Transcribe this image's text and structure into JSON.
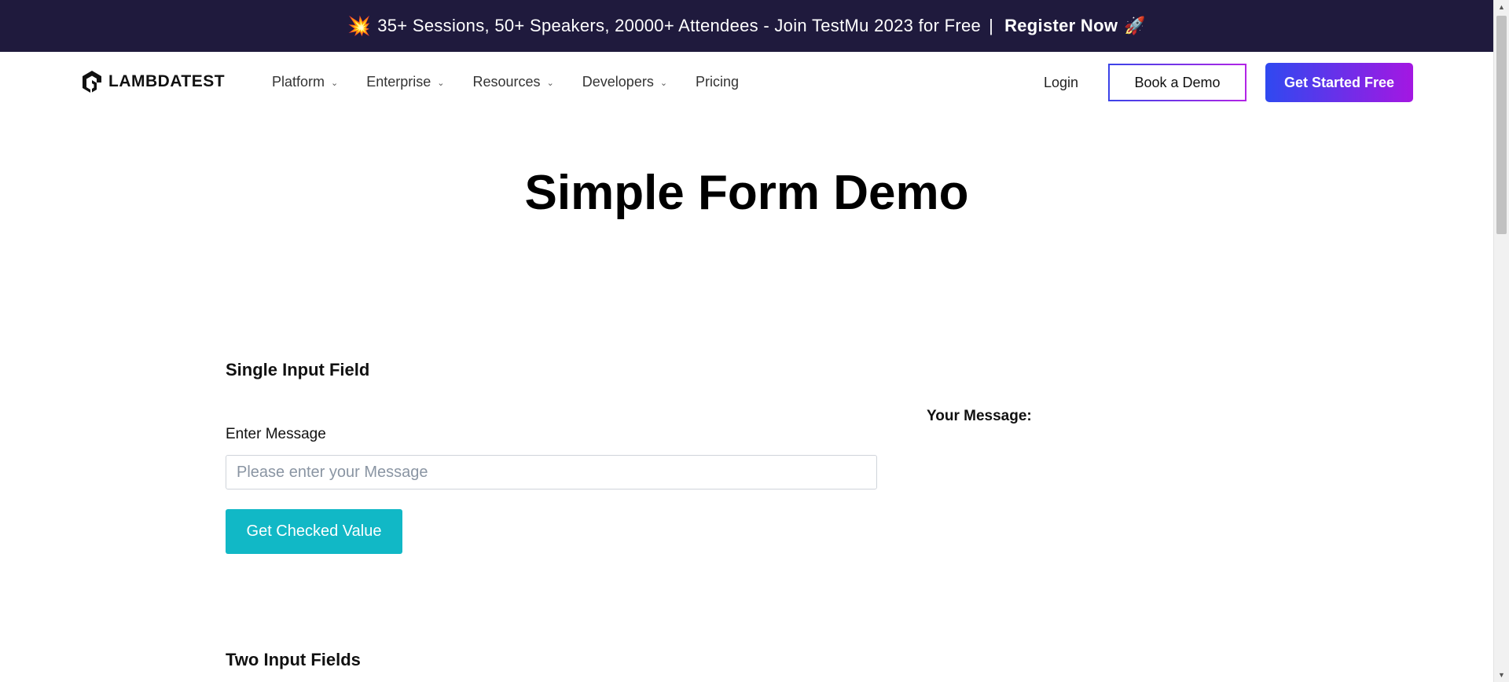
{
  "promo": {
    "icon": "burst-icon",
    "text": "35+ Sessions, 50+ Speakers, 20000+ Attendees - Join TestMu 2023 for Free",
    "separator": "|",
    "cta": "Register Now",
    "cta_icon": "rocket-icon"
  },
  "nav": {
    "logo_text": "LAMBDATEST",
    "items": [
      {
        "label": "Platform",
        "has_dropdown": true
      },
      {
        "label": "Enterprise",
        "has_dropdown": true
      },
      {
        "label": "Resources",
        "has_dropdown": true
      },
      {
        "label": "Developers",
        "has_dropdown": true
      },
      {
        "label": "Pricing",
        "has_dropdown": false
      }
    ],
    "login": "Login",
    "book_demo": "Book a Demo",
    "get_started": "Get Started Free"
  },
  "page": {
    "title": "Simple Form Demo"
  },
  "single_input": {
    "section_title": "Single Input Field",
    "label": "Enter Message",
    "placeholder": "Please enter your Message",
    "value": "",
    "button": "Get Checked Value",
    "result_label": "Your Message:"
  },
  "two_inputs": {
    "section_title": "Two Input Fields"
  },
  "colors": {
    "promo_bg": "#1f1a3d",
    "accent_teal": "#11b8c6",
    "gradient_start": "#2f49f0",
    "gradient_end": "#a417e2"
  }
}
